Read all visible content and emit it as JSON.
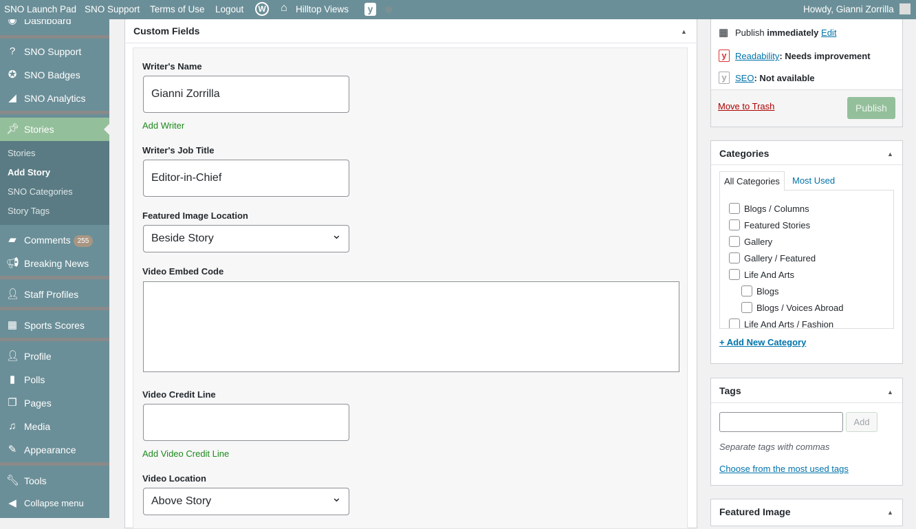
{
  "adminbar": {
    "items": [
      "SNO Launch Pad",
      "SNO Support",
      "Terms of Use",
      "Logout"
    ],
    "site": "Hilltop Views",
    "howdy": "Howdy, Gianni Zorrilla"
  },
  "sidebar": {
    "items": [
      {
        "label": "Dashboard",
        "icon": "dashboard-icon"
      },
      {
        "label": "SNO Support",
        "icon": "help-icon"
      },
      {
        "label": "SNO Badges",
        "icon": "badge-icon"
      },
      {
        "label": "SNO Analytics",
        "icon": "chart-icon"
      },
      {
        "label": "Stories",
        "icon": "pin-icon"
      },
      {
        "label": "Comments",
        "icon": "comment-icon",
        "count": "255"
      },
      {
        "label": "Breaking News",
        "icon": "megaphone-icon"
      },
      {
        "label": "Staff Profiles",
        "icon": "user-icon"
      },
      {
        "label": "Sports Scores",
        "icon": "calendar-icon"
      },
      {
        "label": "Profile",
        "icon": "user-icon"
      },
      {
        "label": "Polls",
        "icon": "poll-icon"
      },
      {
        "label": "Pages",
        "icon": "pages-icon"
      },
      {
        "label": "Media",
        "icon": "media-icon"
      },
      {
        "label": "Appearance",
        "icon": "brush-icon"
      },
      {
        "label": "Tools",
        "icon": "wrench-icon"
      },
      {
        "label": "Collapse menu",
        "icon": "collapse-icon"
      }
    ],
    "submenu": [
      "Stories",
      "Add Story",
      "SNO Categories",
      "Story Tags"
    ]
  },
  "custom_fields": {
    "title": "Custom Fields",
    "writer_name_label": "Writer's Name",
    "writer_name": "Gianni Zorrilla",
    "add_writer": "Add Writer",
    "job_title_label": "Writer's Job Title",
    "job_title": "Editor-in-Chief",
    "image_location_label": "Featured Image Location",
    "image_location": "Beside Story",
    "video_embed_label": "Video Embed Code",
    "video_embed": "",
    "video_credit_label": "Video Credit Line",
    "video_credit": "",
    "add_credit": "Add Video Credit Line",
    "video_location_label": "Video Location",
    "video_location": "Above Story"
  },
  "publish": {
    "publish_text": "Publish ",
    "immediately": "immediately",
    "edit": "Edit",
    "readability": "Readability",
    "readability_status": ": Needs improvement",
    "seo": "SEO",
    "seo_status": ": Not available",
    "trash": "Move to Trash",
    "publish_button": "Publish"
  },
  "categories": {
    "title": "Categories",
    "tabs": [
      "All Categories",
      "Most Used"
    ],
    "items": [
      "Blogs / Columns",
      "Featured Stories",
      "Gallery",
      "Gallery / Featured",
      "Life And Arts",
      "Blogs",
      "Blogs / Voices Abroad",
      "Life And Arts / Fashion"
    ],
    "add_new": "+ Add New Category"
  },
  "tags": {
    "title": "Tags",
    "input": "",
    "add": "Add",
    "hint": "Separate tags with commas",
    "choose": "Choose from the most used tags"
  },
  "featured_image": {
    "title": "Featured Image"
  }
}
